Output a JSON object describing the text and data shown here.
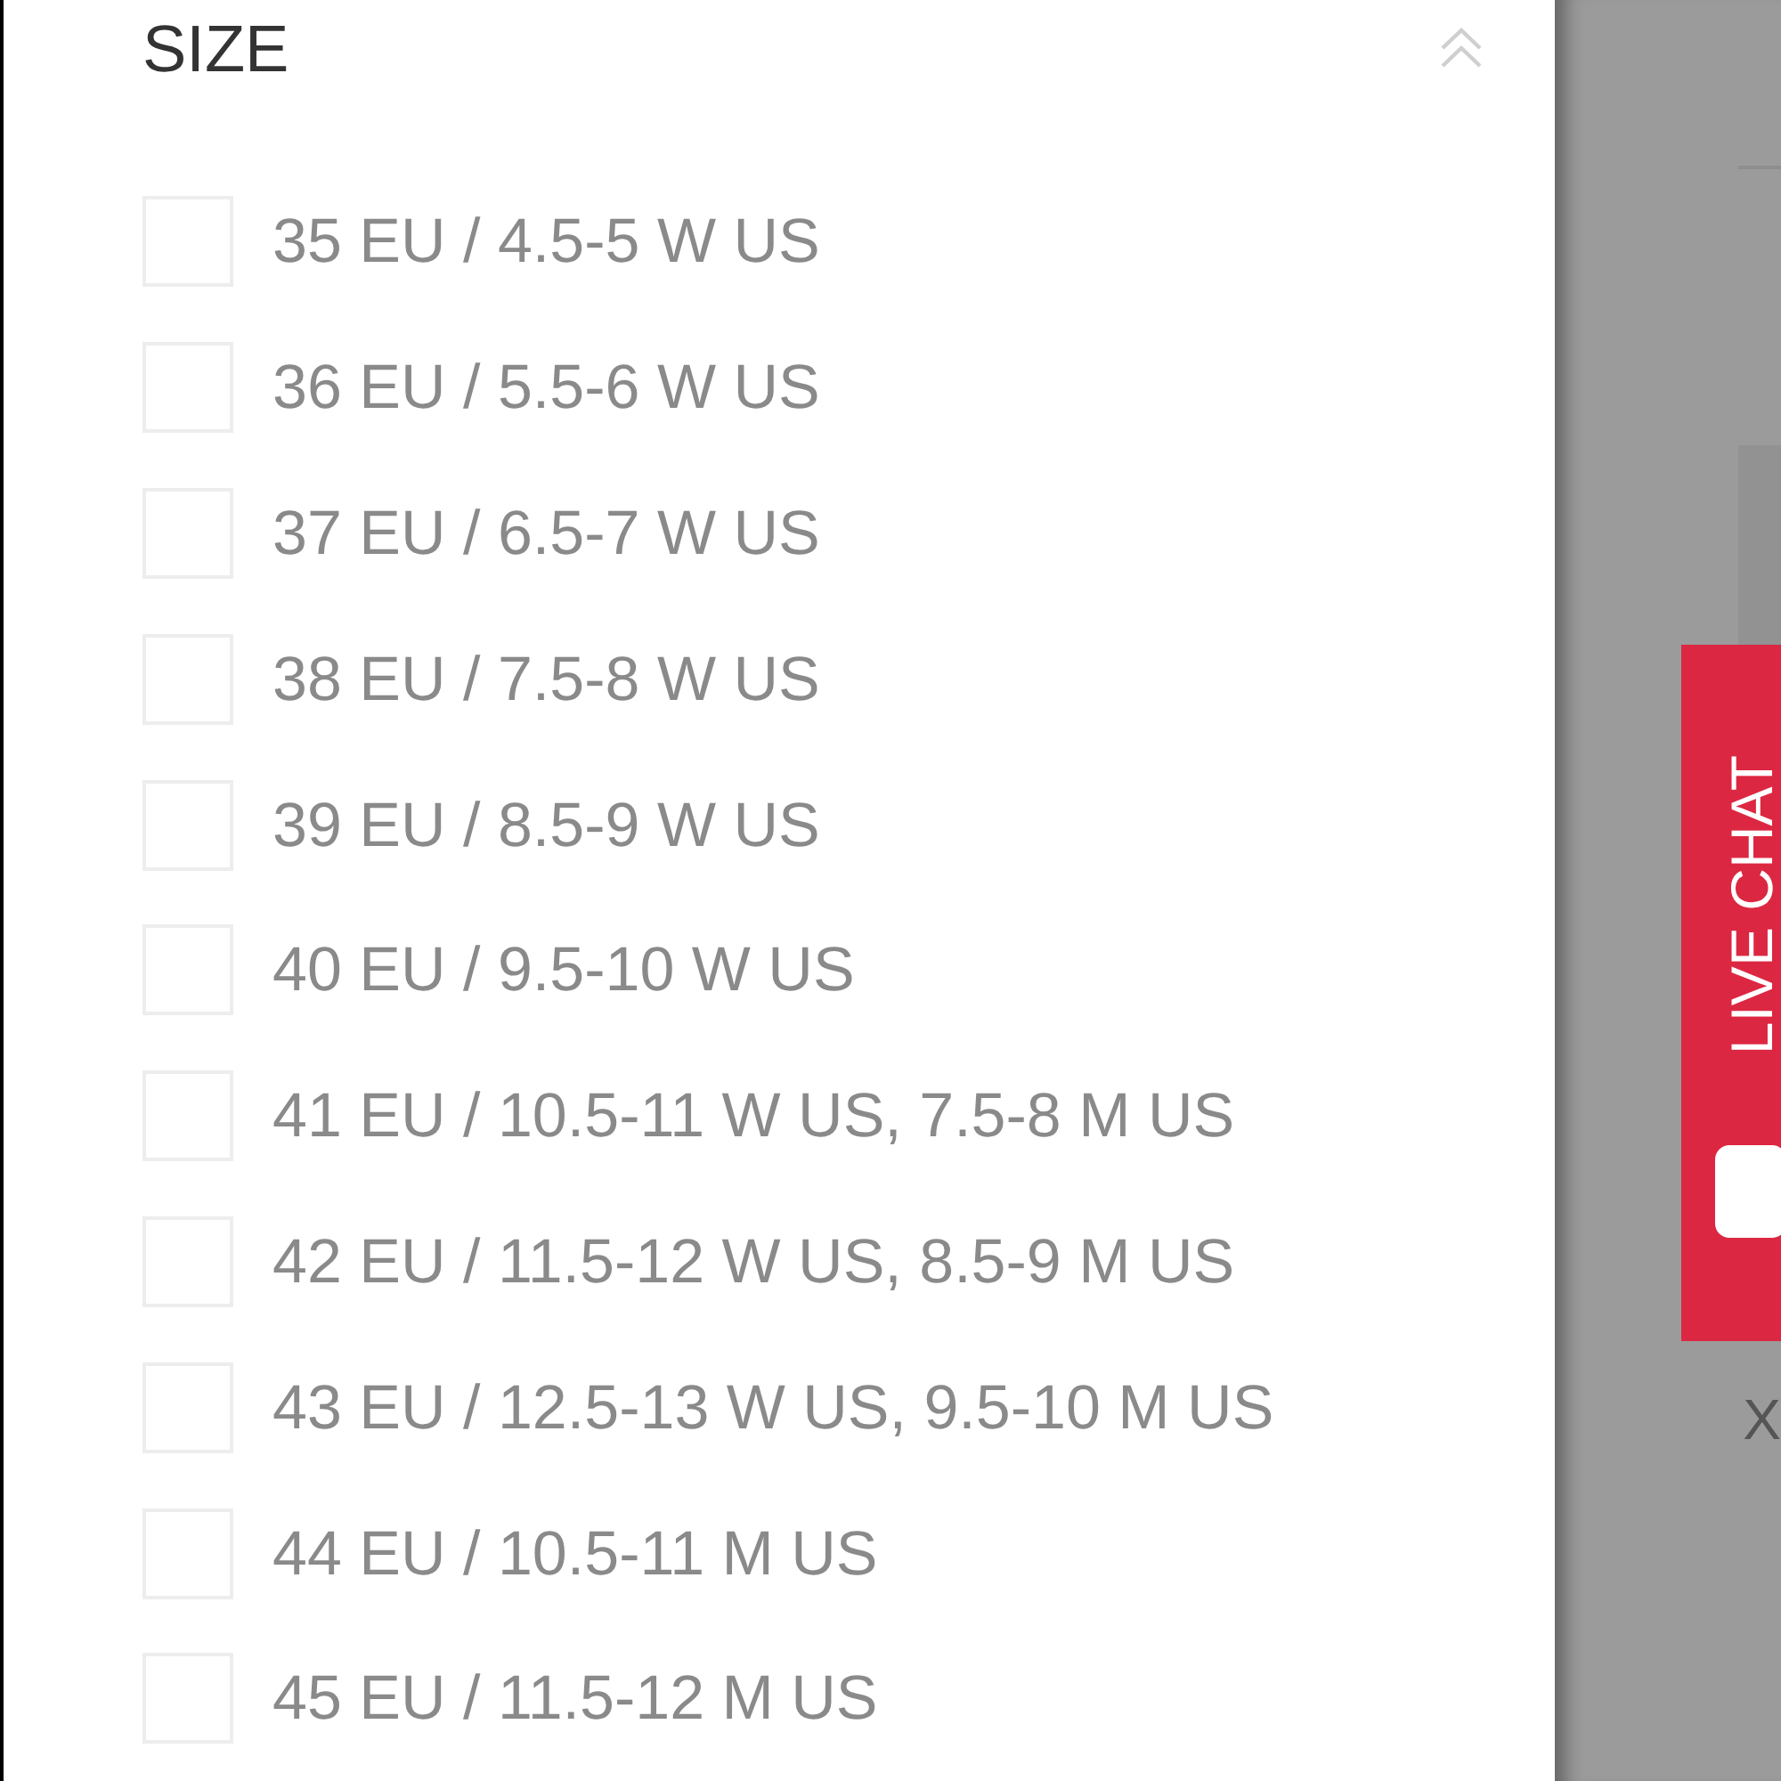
{
  "filter": {
    "title": "SIZE",
    "expanded": true,
    "options": [
      {
        "label": "35 EU / 4.5-5 W US",
        "checked": false
      },
      {
        "label": "36 EU / 5.5-6 W US",
        "checked": false
      },
      {
        "label": "37 EU / 6.5-7 W US",
        "checked": false
      },
      {
        "label": "38 EU / 7.5-8 W US",
        "checked": false
      },
      {
        "label": "39 EU / 8.5-9 W US",
        "checked": false
      },
      {
        "label": "40 EU / 9.5-10 W US",
        "checked": false
      },
      {
        "label": "41 EU / 10.5-11 W US, 7.5-8 M US",
        "checked": false
      },
      {
        "label": "42 EU / 11.5-12 W US, 8.5-9 M US",
        "checked": false
      },
      {
        "label": "43 EU / 12.5-13 W US, 9.5-10 M US",
        "checked": false
      },
      {
        "label": "44 EU / 10.5-11 M US",
        "checked": false
      },
      {
        "label": "45 EU / 11.5-12 M US",
        "checked": false
      }
    ]
  },
  "live_chat": {
    "label": "LIVE CHAT"
  },
  "close_label": "X"
}
